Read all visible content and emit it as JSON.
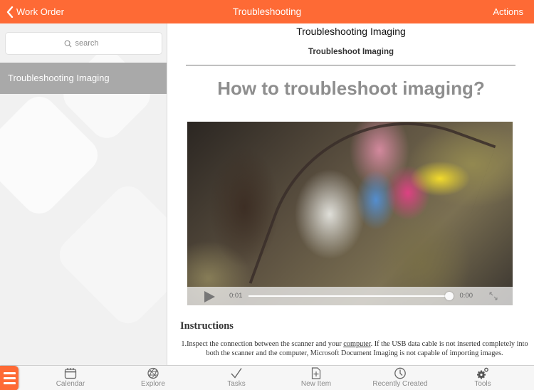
{
  "navbar": {
    "back_label": "Work Order",
    "title": "Troubleshooting",
    "actions_label": "Actions",
    "color": "#fe6a35"
  },
  "sidebar": {
    "search_placeholder": "search",
    "items": [
      {
        "label": "Troubleshooting Imaging",
        "selected": true
      }
    ]
  },
  "document": {
    "title": "Troubleshooting Imaging",
    "subtitle": "Troubleshoot Imaging",
    "heading": "How to troubleshoot imaging?",
    "video": {
      "current_time": "0:01",
      "end_time": "0:00",
      "progress": 1.0,
      "play_icon": "play-icon",
      "fullscreen_icon": "fullscreen-icon"
    },
    "instructions_title": "Instructions",
    "instructions": [
      {
        "prefix": "1.Inspect the connection between the scanner and your ",
        "link": "computer",
        "suffix": ". If the USB data cable is not inserted completely into both the scanner and the computer, Microsoft Document Imaging is not capable of importing images."
      }
    ]
  },
  "tabbar": {
    "menu_icon": "hamburger-menu-icon",
    "tabs": [
      {
        "label": "Calendar",
        "icon": "calendar-icon"
      },
      {
        "label": "Explore",
        "icon": "globe-icon"
      },
      {
        "label": "Tasks",
        "icon": "checkmark-icon"
      },
      {
        "label": "New Item",
        "icon": "new-document-icon"
      },
      {
        "label": "Recently Created",
        "icon": "clock-icon"
      },
      {
        "label": "Tools",
        "icon": "gears-icon"
      }
    ]
  }
}
